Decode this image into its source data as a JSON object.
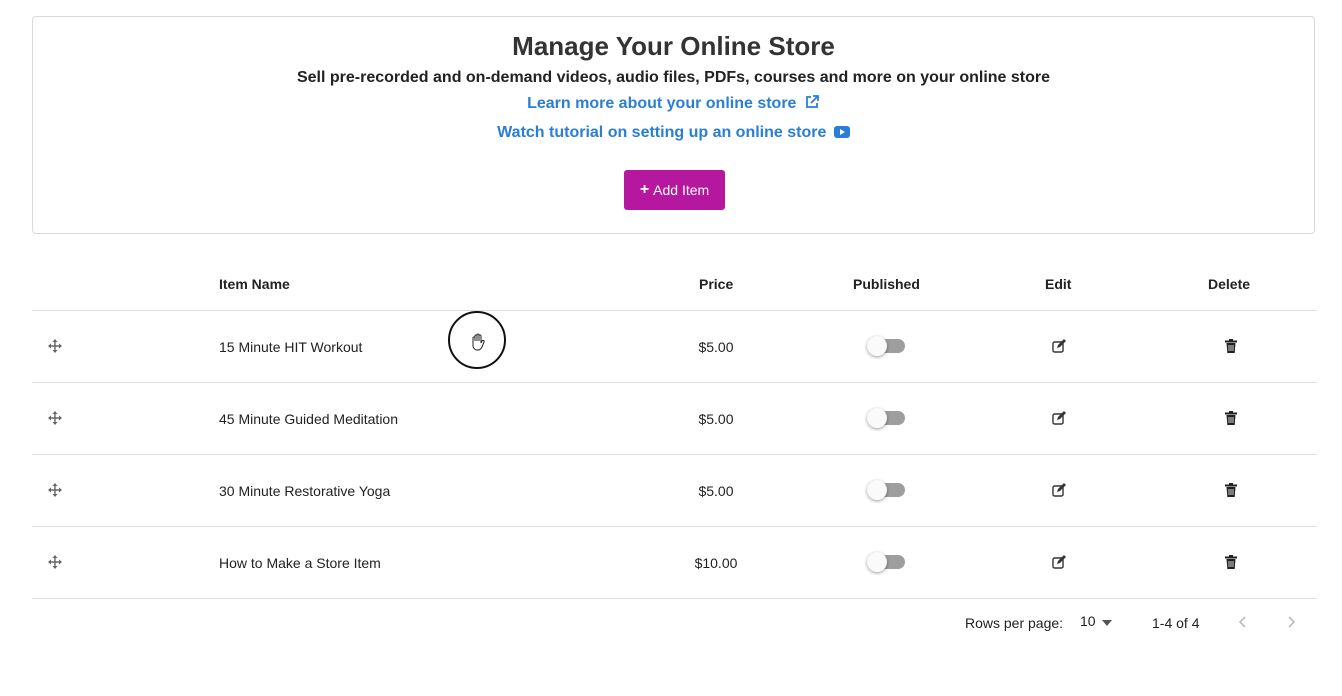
{
  "header": {
    "title": "Manage Your Online Store",
    "subtitle": "Sell pre-recorded and on-demand videos, audio files, PDFs, courses and more on your online store",
    "learn_link": "Learn more about your online store",
    "tutorial_link": "Watch tutorial on setting up an online store",
    "add_button": "Add Item",
    "accent_color": "#b5179e",
    "link_color": "#2a7fd4"
  },
  "table": {
    "columns": [
      "Item Name",
      "Price",
      "Published",
      "Edit",
      "Delete"
    ],
    "rows": [
      {
        "name": "15 Minute HIT Workout",
        "price": "$5.00",
        "published": false
      },
      {
        "name": "45 Minute Guided Meditation",
        "price": "$5.00",
        "published": false
      },
      {
        "name": "30 Minute Restorative Yoga",
        "price": "$5.00",
        "published": false
      },
      {
        "name": "How to Make a Store Item",
        "price": "$10.00",
        "published": false
      }
    ]
  },
  "pagination": {
    "rows_per_page_label": "Rows per page:",
    "rows_per_page_value": "10",
    "range_text": "1-4 of 4"
  }
}
